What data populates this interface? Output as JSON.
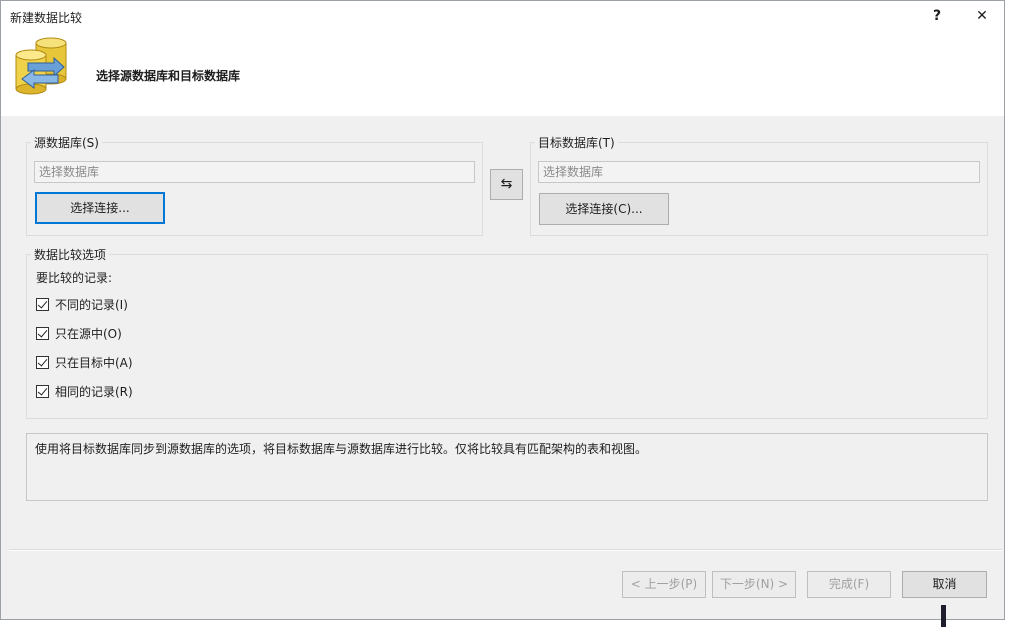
{
  "window": {
    "title": "新建数据比较",
    "help_glyph": "?",
    "close_glyph": "✕"
  },
  "header": {
    "text": "选择源数据库和目标数据库"
  },
  "source": {
    "legend": "源数据库(S)",
    "placeholder": "选择数据库",
    "button_label": "选择连接..."
  },
  "swap_glyph": "⇆",
  "target": {
    "legend": "目标数据库(T)",
    "placeholder": "选择数据库",
    "button_label": "选择连接(C)..."
  },
  "options": {
    "legend": "数据比较选项",
    "records_label": "要比较的记录:",
    "checks": [
      {
        "label": "不同的记录(I)",
        "checked": true
      },
      {
        "label": "只在源中(O)",
        "checked": true
      },
      {
        "label": "只在目标中(A)",
        "checked": true
      },
      {
        "label": "相同的记录(R)",
        "checked": true
      }
    ]
  },
  "description": "使用将目标数据库同步到源数据库的选项，将目标数据库与源数据库进行比较。仅将比较具有匹配架构的表和视图。",
  "footer": {
    "prev_label": "< 上一步(P)",
    "next_label": "下一步(N) >",
    "finish_label": "完成(F)",
    "cancel_label": "取消"
  },
  "colors": {
    "focus_border": "#0078d7",
    "dialog_bg": "#f0f0f0",
    "header_bg": "#ffffff"
  },
  "icons": {
    "header": "database-compare-icon",
    "swap": "swap-arrows-icon",
    "close": "close-icon",
    "help": "help-icon"
  }
}
